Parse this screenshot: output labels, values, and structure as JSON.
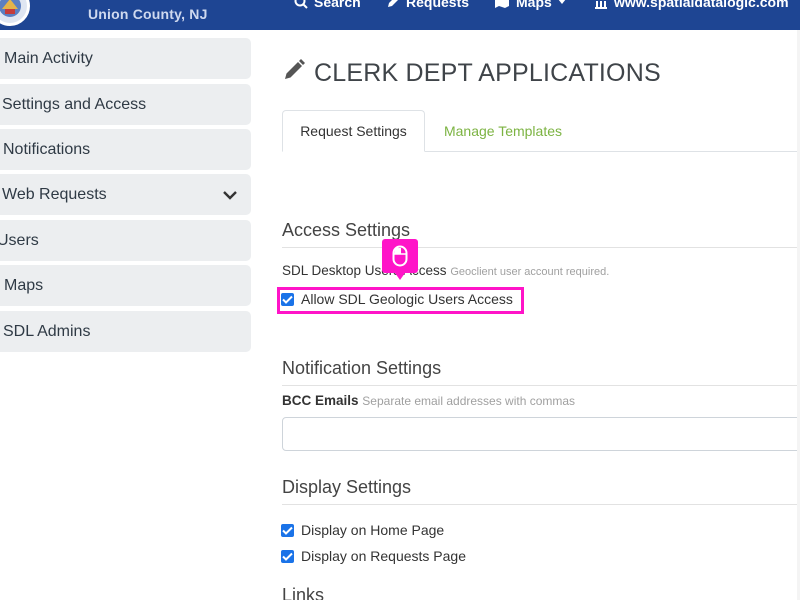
{
  "header": {
    "county": "Union County, NJ",
    "nav": {
      "search": "Search",
      "requests": "Requests",
      "maps": "Maps",
      "website": "www.spatialdatalogic.com"
    }
  },
  "sidebar": {
    "items": [
      {
        "label": "Main Activity"
      },
      {
        "label": "Settings and Access"
      },
      {
        "label": "Notifications"
      },
      {
        "label": "Web Requests"
      },
      {
        "label": "Users"
      },
      {
        "label": "Maps"
      },
      {
        "label": "SDL Admins"
      }
    ]
  },
  "main": {
    "title": "CLERK DEPT APPLICATIONS",
    "tabs": [
      {
        "label": "Request Settings",
        "active": true
      },
      {
        "label": "Manage Templates",
        "active": false
      }
    ],
    "access": {
      "heading": "Access Settings",
      "desktop_label": "SDL Desktop Users Access",
      "desktop_help": "Geoclient user account required.",
      "geologic_checkbox": {
        "label": "Allow SDL Geologic Users Access",
        "checked": true
      }
    },
    "notification": {
      "heading": "Notification Settings",
      "bcc_label": "BCC Emails",
      "bcc_help": "Separate email addresses with commas",
      "bcc_value": ""
    },
    "display": {
      "heading": "Display Settings",
      "home_checkbox": {
        "label": "Display on Home Page",
        "checked": true
      },
      "requests_checkbox": {
        "label": "Display on Requests Page",
        "checked": true
      }
    },
    "links": {
      "heading": "Links"
    }
  },
  "colors": {
    "navbar": "#1e4593",
    "accent_green": "#7cb342",
    "highlight": "#ff14c8",
    "checkbox": "#1a73e8"
  },
  "icons": {
    "title": "pencil-icon",
    "search": "search-icon",
    "requests": "edit-icon",
    "maps": "map-icon",
    "website": "building-icon",
    "dropdown": "chevron-down-icon",
    "cursor": "mouse-icon"
  }
}
